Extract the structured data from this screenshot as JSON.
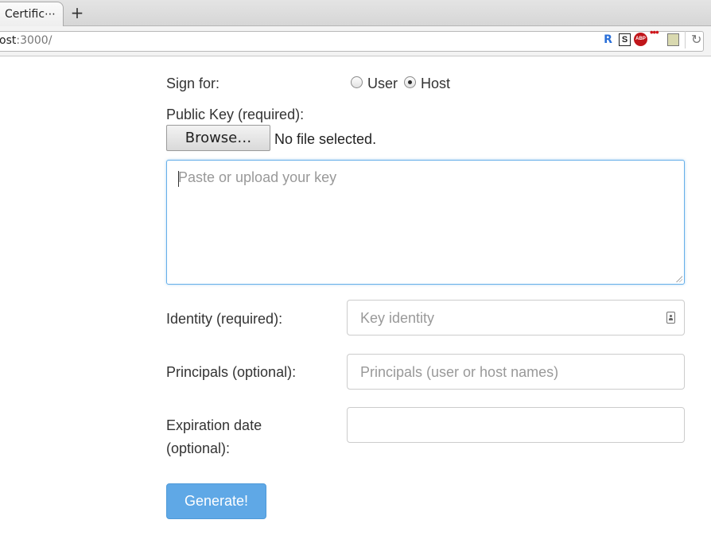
{
  "browser": {
    "tab_title": "Certific⋯",
    "new_tab_label": "+",
    "url_host": "ost",
    "url_rest": ":3000/",
    "extensions": [
      "bookmark-icon",
      "s-extension-icon",
      "adblock-plus-icon",
      "dots-extension-icon",
      "document-extension-icon"
    ],
    "ext_r_label": "R",
    "ext_s_label": "S",
    "ext_abp_label": "ABP",
    "ext_dots_label": "•••",
    "reload_label": "↻"
  },
  "form": {
    "sign_for_label": "Sign for:",
    "radio_user_label": "User",
    "radio_host_label": "Host",
    "selected": "Host",
    "public_key_label": "Public Key (required):",
    "browse_label": "Browse…",
    "no_file_label": "No file selected.",
    "key_placeholder": "Paste or upload your key",
    "identity_label": "Identity (required):",
    "identity_placeholder": "Key identity",
    "principals_label": "Principals (optional):",
    "principals_placeholder": "Principals (user or host names)",
    "expiration_label_1": "Expiration date",
    "expiration_label_2": "(optional):",
    "expiration_value": "",
    "generate_label": "Generate!"
  },
  "colors": {
    "accent": "#5fa8e6",
    "focus_border": "#66afe9"
  }
}
